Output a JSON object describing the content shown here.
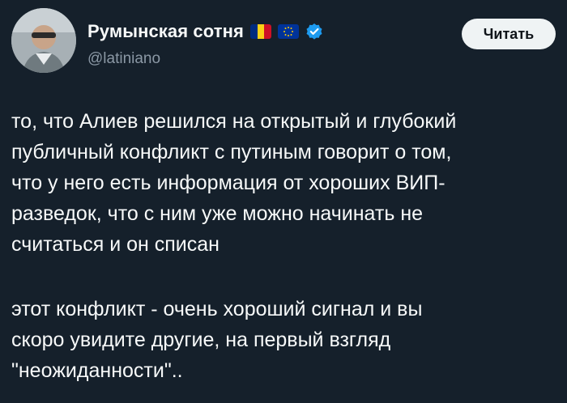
{
  "author": {
    "display_name": "Румынская сотня",
    "handle": "@latiniano",
    "flags": [
      "flag-romania",
      "flag-eu"
    ],
    "verified_icon": "verified-badge-icon",
    "avatar_icon": "avatar-photo"
  },
  "actions": {
    "follow_label": "Читать"
  },
  "tweet": {
    "paragraphs": [
      "то, что Алиев решился на открытый и глубокий\nпубличный конфликт с путиным говорит о том,\nчто у него есть информация от хороших ВИП-\nразведок, что с ним уже можно начинать не\nсчитаться и он списан",
      "этот конфликт - очень хороший сигнал и вы\nскоро увидите другие, на первый взгляд\n\"неожиданности\".."
    ]
  },
  "colors": {
    "background": "#15202b",
    "text_primary": "#f7f9f9",
    "text_secondary": "#8b98a5",
    "verified": "#1d9bf0",
    "button_bg": "#eff3f4"
  }
}
